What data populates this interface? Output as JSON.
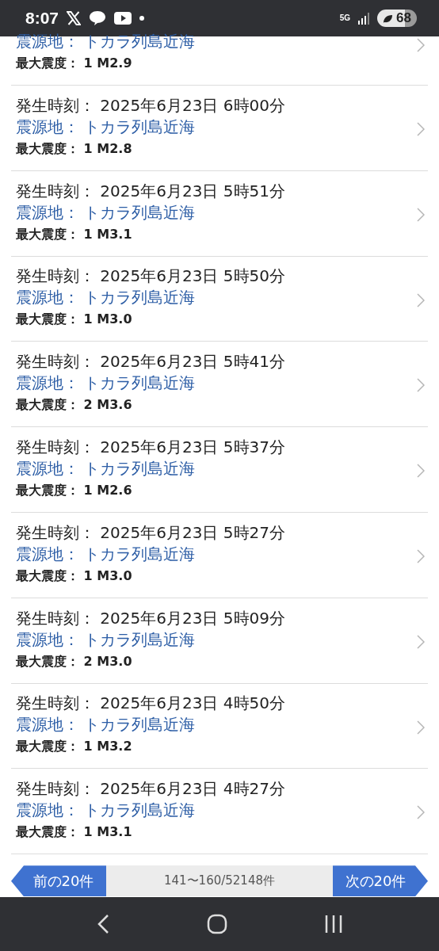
{
  "status_bar": {
    "time": "8:07",
    "network": "5G",
    "battery": "68"
  },
  "quakes": [
    {
      "epicenter_label": "震源地：",
      "epicenter": "トカラ列島近海",
      "intensity_label": "最大震度：",
      "intensity": "1",
      "magnitude": "M2.9"
    },
    {
      "time_label": "発生時刻：",
      "time": "2025年6月23日 6時00分",
      "epicenter_label": "震源地：",
      "epicenter": "トカラ列島近海",
      "intensity_label": "最大震度：",
      "intensity": "1",
      "magnitude": "M2.8"
    },
    {
      "time_label": "発生時刻：",
      "time": "2025年6月23日 5時51分",
      "epicenter_label": "震源地：",
      "epicenter": "トカラ列島近海",
      "intensity_label": "最大震度：",
      "intensity": "1",
      "magnitude": "M3.1"
    },
    {
      "time_label": "発生時刻：",
      "time": "2025年6月23日 5時50分",
      "epicenter_label": "震源地：",
      "epicenter": "トカラ列島近海",
      "intensity_label": "最大震度：",
      "intensity": "1",
      "magnitude": "M3.0"
    },
    {
      "time_label": "発生時刻：",
      "time": "2025年6月23日 5時41分",
      "epicenter_label": "震源地：",
      "epicenter": "トカラ列島近海",
      "intensity_label": "最大震度：",
      "intensity": "2",
      "magnitude": "M3.6"
    },
    {
      "time_label": "発生時刻：",
      "time": "2025年6月23日 5時37分",
      "epicenter_label": "震源地：",
      "epicenter": "トカラ列島近海",
      "intensity_label": "最大震度：",
      "intensity": "1",
      "magnitude": "M2.6"
    },
    {
      "time_label": "発生時刻：",
      "time": "2025年6月23日 5時27分",
      "epicenter_label": "震源地：",
      "epicenter": "トカラ列島近海",
      "intensity_label": "最大震度：",
      "intensity": "1",
      "magnitude": "M3.0"
    },
    {
      "time_label": "発生時刻：",
      "time": "2025年6月23日 5時09分",
      "epicenter_label": "震源地：",
      "epicenter": "トカラ列島近海",
      "intensity_label": "最大震度：",
      "intensity": "2",
      "magnitude": "M3.0"
    },
    {
      "time_label": "発生時刻：",
      "time": "2025年6月23日 4時50分",
      "epicenter_label": "震源地：",
      "epicenter": "トカラ列島近海",
      "intensity_label": "最大震度：",
      "intensity": "1",
      "magnitude": "M3.2"
    },
    {
      "time_label": "発生時刻：",
      "time": "2025年6月23日 4時27分",
      "epicenter_label": "震源地：",
      "epicenter": "トカラ列島近海",
      "intensity_label": "最大震度：",
      "intensity": "1",
      "magnitude": "M3.1"
    }
  ],
  "pagination": {
    "previous": "前の20件",
    "range": "141〜160/52148件",
    "next": "次の20件"
  }
}
